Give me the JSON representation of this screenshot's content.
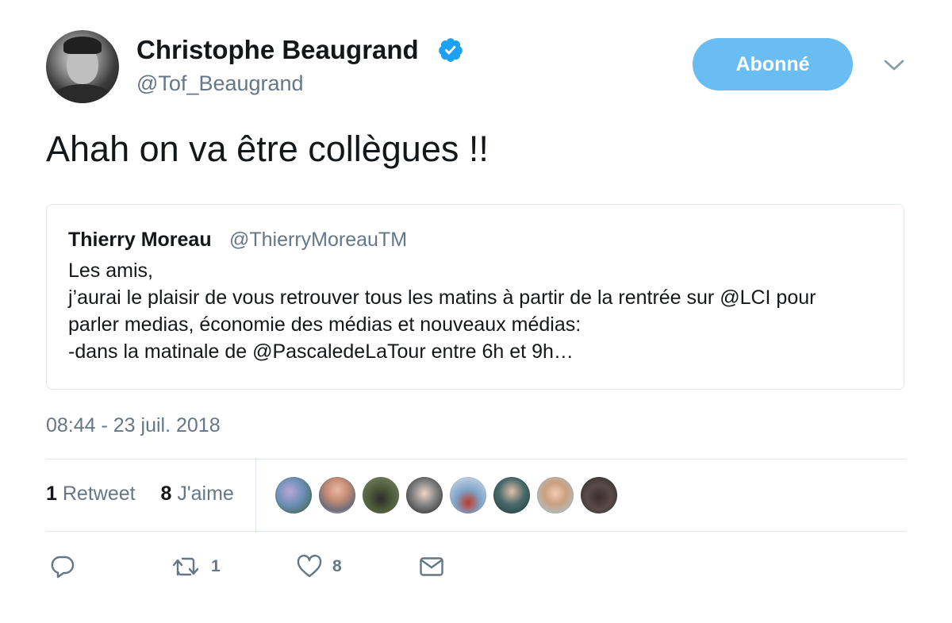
{
  "author": {
    "display_name": "Christophe Beaugrand",
    "handle": "@Tof_Beaugrand",
    "verified": true
  },
  "header": {
    "follow_label": "Abonné"
  },
  "tweet": {
    "text": "Ahah on va être collègues !!",
    "timestamp": "08:44 - 23 juil. 2018"
  },
  "quoted_tweet": {
    "author_name": "Thierry Moreau",
    "author_handle": "@ThierryMoreauTM",
    "lines": [
      "Les amis,",
      "j’aurai le plaisir de vous retrouver tous les matins à partir de la rentrée sur @LCI pour",
      "parler medias, économie des médias et nouveaux médias:",
      "-dans la matinale de @PascaledeLaTour entre 6h et 9h…"
    ]
  },
  "stats": {
    "retweets_count": "1",
    "retweets_label": "Retweet",
    "likes_count": "8",
    "likes_label": "J'aime"
  },
  "actions": {
    "retweet_count": "1",
    "like_count": "8"
  },
  "colors": {
    "accent": "#1da1f2",
    "follow_button": "#69bdf3",
    "secondary_text": "#657786",
    "border": "#e1e8ed"
  },
  "icons": {
    "reply": "reply-icon",
    "retweet": "retweet-icon",
    "like": "heart-icon",
    "message": "envelope-icon",
    "verified": "verified-badge-icon",
    "menu": "chevron-down-icon"
  }
}
